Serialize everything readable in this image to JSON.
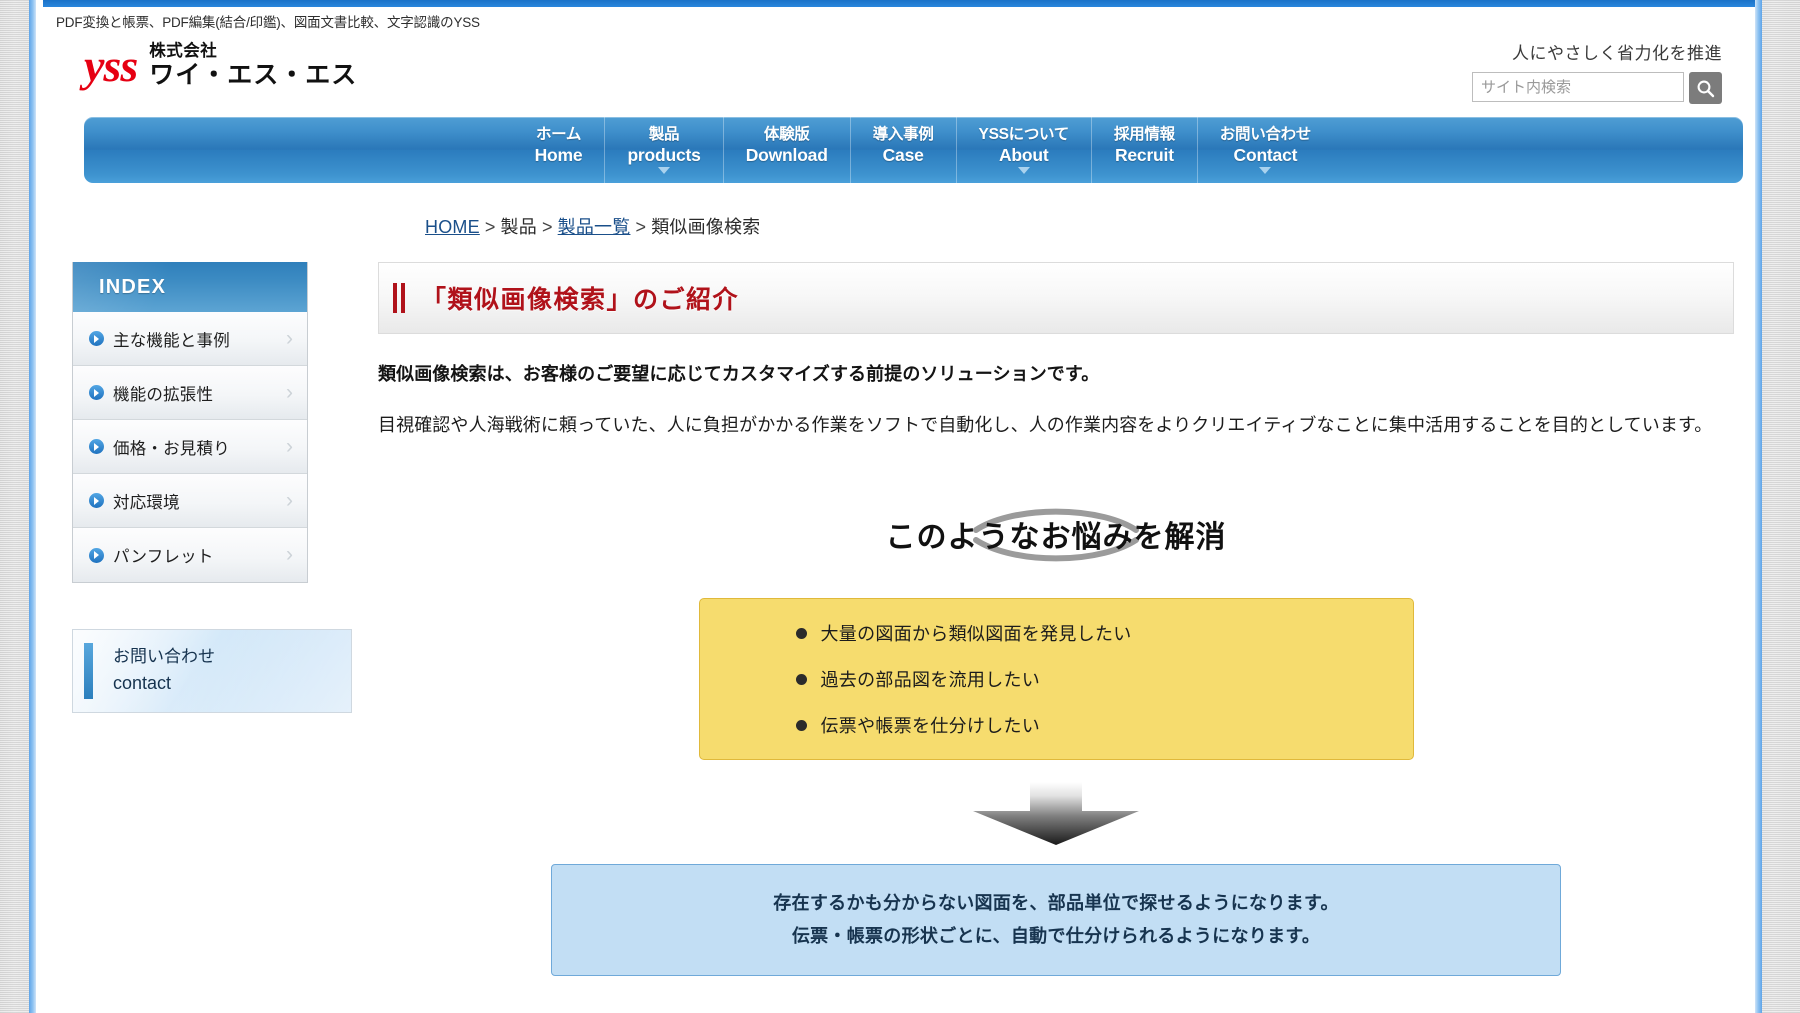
{
  "browser": {
    "tagline_strip": "PDF変換と帳票、PDF編集(結合/印鑑)、図面文書比較、文字認識のYSS"
  },
  "header": {
    "logo_mark": "yss",
    "logo_line1": "株式会社",
    "logo_line2": "ワイ・エス・エス",
    "slogan": "人にやさしく省力化を推進",
    "search": {
      "placeholder": "サイト内検索",
      "value": "",
      "button_icon": "search-icon"
    }
  },
  "globalnav": {
    "items": [
      {
        "jp": "ホーム",
        "en": "Home",
        "caret": false
      },
      {
        "jp": "製品",
        "en": "products",
        "caret": true
      },
      {
        "jp": "体験版",
        "en": "Download",
        "caret": false
      },
      {
        "jp": "導入事例",
        "en": "Case",
        "caret": false
      },
      {
        "jp": "YSSについて",
        "en": "About",
        "caret": true
      },
      {
        "jp": "採用情報",
        "en": "Recruit",
        "caret": false
      },
      {
        "jp": "お問い合わせ",
        "en": "Contact",
        "caret": true
      }
    ]
  },
  "breadcrumb": {
    "items": [
      {
        "label": "HOME",
        "link": true
      },
      {
        "label": "製品",
        "link": false
      },
      {
        "label": "製品一覧",
        "link": true
      },
      {
        "label": "類似画像検索",
        "link": false
      }
    ],
    "separator": ">"
  },
  "sidebar": {
    "index_title": "INDEX",
    "items": [
      {
        "label": "主な機能と事例"
      },
      {
        "label": "機能の拡張性"
      },
      {
        "label": "価格・お見積り"
      },
      {
        "label": "対応環境"
      },
      {
        "label": "パンフレット"
      }
    ],
    "chevron": "›",
    "contact": {
      "jp": "お問い合わせ",
      "en": "contact"
    }
  },
  "main": {
    "page_title": "「類似画像検索」のご紹介",
    "lead": "類似画像検索は、お客様のご要望に応じてカスタマイズする前提のソリューションです。",
    "paragraph": "目視確認や人海戦術に頼っていた、人に負担がかかる作業をソフトで自動化し、人の作業内容をよりクリエイティブなことに集中活用することを目的としています。",
    "arc_heading": "このようなお悩みを解消",
    "problem_items": [
      "大量の図面から類似図面を発見したい",
      "過去の部品図を流用したい",
      "伝票や帳票を仕分けしたい"
    ],
    "result_lines": [
      "存在するかも分からない図面を、部品単位で探せるようになります。",
      "伝票・帳票の形状ごとに、自動で仕分けられるようになります。"
    ]
  },
  "colors": {
    "nav_blue": "#2a77b8",
    "title_red": "#b0121a",
    "logo_red": "#e60012",
    "yellow_box": "#f6dc6e",
    "yellow_border": "#e0b93b",
    "blue_box": "#c2def4",
    "blue_border": "#6fa9d9",
    "index_head": "#3d8cc3"
  }
}
